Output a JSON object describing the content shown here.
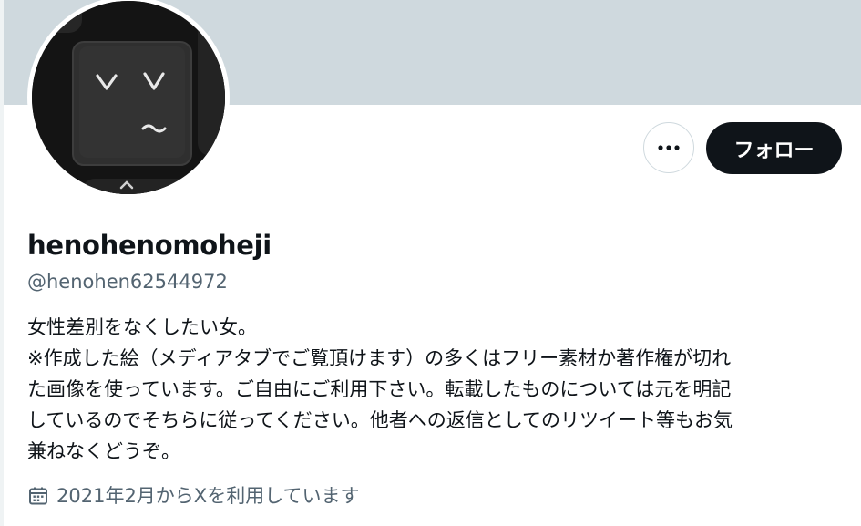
{
  "profile": {
    "display_name": "henohenomoheji",
    "handle": "@henohen62544972",
    "bio_lines": [
      "女性差別をなくしたい女。",
      "※作成した絵（メディアタブでご覧頂けます）の多くはフリー素材か著作権が切れ",
      "た画像を使っています。ご自由にご利用下さい。転載したものについては元を明記",
      "しているのでそちらに従ってください。他者への返信としてのリツイート等もお気",
      "兼ねなくどうぞ。"
    ],
    "joined": "2021年2月からXを利用しています"
  },
  "actions": {
    "follow_label": "フォロー",
    "more_icon": "ellipsis-icon"
  },
  "colors": {
    "banner": "#cfd9de",
    "primary_text": "#0f1419",
    "secondary_text": "#536471",
    "follow_bg": "#0f1419"
  }
}
